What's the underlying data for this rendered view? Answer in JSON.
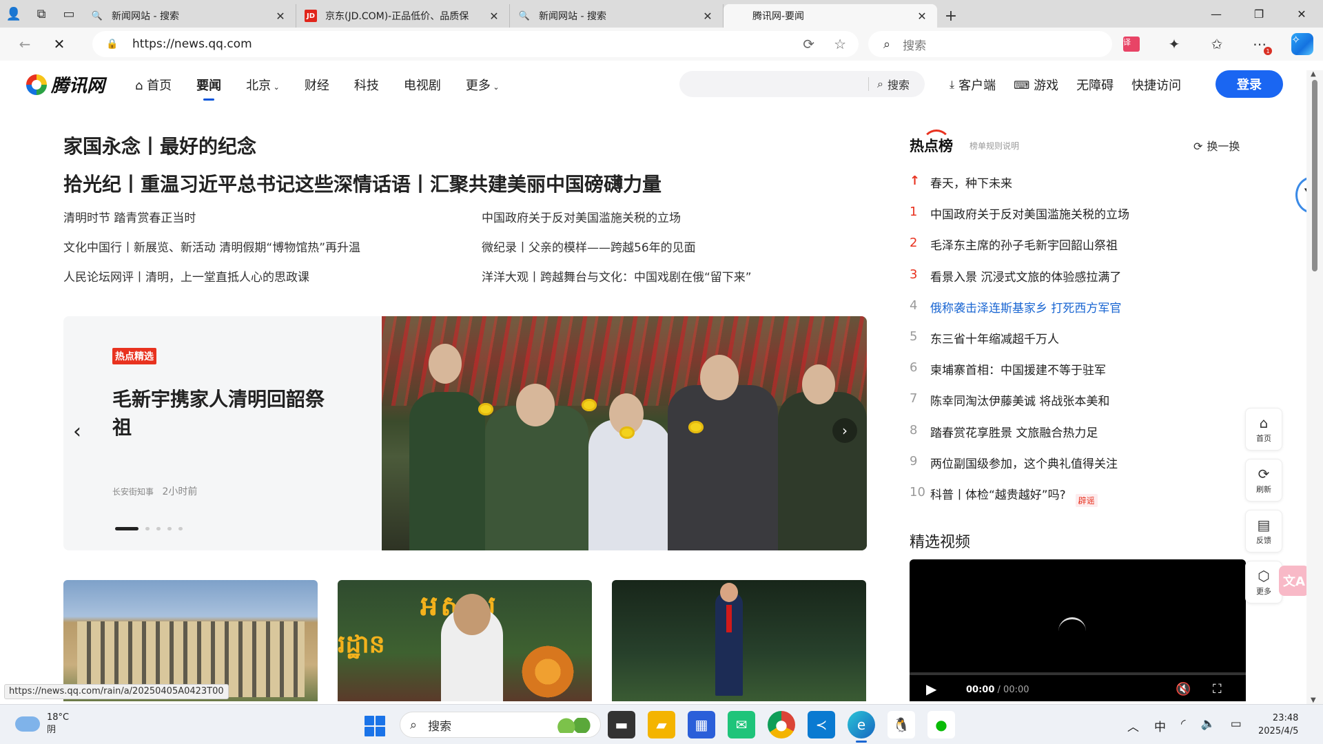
{
  "browser": {
    "tabs": [
      {
        "title": "新闻网站 - 搜索",
        "favicon": "search-icon",
        "active": false
      },
      {
        "title": "京东(JD.COM)-正品低价、品质保",
        "favicon": "jd-icon",
        "active": false
      },
      {
        "title": "新闻网站 - 搜索",
        "favicon": "search-icon",
        "active": false
      },
      {
        "title": "腾讯网-要闻",
        "favicon": "",
        "active": true
      }
    ],
    "url": "https://news.qq.com",
    "search_placeholder": "搜索"
  },
  "site": {
    "logo_text": "腾讯网",
    "nav": [
      {
        "label": "首页",
        "icon": "home-icon"
      },
      {
        "label": "要闻",
        "active": true
      },
      {
        "label": "北京",
        "dropdown": true
      },
      {
        "label": "财经"
      },
      {
        "label": "科技"
      },
      {
        "label": "电视剧"
      },
      {
        "label": "更多",
        "dropdown": true
      }
    ],
    "search_button": "搜索",
    "right_links": [
      {
        "label": "客户端",
        "icon": "download-icon"
      },
      {
        "label": "游戏",
        "icon": "gamepad-icon"
      },
      {
        "label": "无障碍"
      },
      {
        "label": "快捷访问"
      }
    ],
    "login": "登录"
  },
  "headlines": {
    "main1": "家国永念丨最好的纪念",
    "main2": "拾光纪丨重温习近平总书记这些深情话语丨汇聚共建美丽中国磅礴力量",
    "left": [
      "清明时节 踏青赏春正当时",
      "文化中国行丨新展览、新活动 清明假期“博物馆热”再升温",
      "人民论坛网评丨清明，上一堂直抵人心的思政课"
    ],
    "right": [
      "中国政府关于反对美国滥施关税的立场",
      "微纪录丨父亲的模样——跨越56年的见面",
      "洋洋大观丨跨越舞台与文化：中国戏剧在俄“留下来”"
    ]
  },
  "carousel": {
    "tag": "热点精选",
    "title": "毛新宇携家人清明回韶祭祖",
    "source": "长安街知事",
    "time": "2小时前",
    "dots": 5,
    "active_dot": 0
  },
  "hot": {
    "title": "热点榜",
    "rule": "榜单规则说明",
    "refresh": "换一换",
    "items": [
      {
        "rank": "↑",
        "title": "春天，种下未来",
        "pinned": true
      },
      {
        "rank": "1",
        "title": "中国政府关于反对美国滥施关税的立场"
      },
      {
        "rank": "2",
        "title": "毛泽东主席的孙子毛新宇回韶山祭祖"
      },
      {
        "rank": "3",
        "title": "看景入景 沉浸式文旅的体验感拉满了"
      },
      {
        "rank": "4",
        "title": "俄称袭击泽连斯基家乡 打死西方军官",
        "highlight": true
      },
      {
        "rank": "5",
        "title": "东三省十年缩减超千万人"
      },
      {
        "rank": "6",
        "title": "柬埔寨首相：中国援建不等于驻军"
      },
      {
        "rank": "7",
        "title": "陈幸同淘汰伊藤美诚 将战张本美和"
      },
      {
        "rank": "8",
        "title": "踏春赏花享胜景 文旅融合热力足"
      },
      {
        "rank": "9",
        "title": "两位副国级参加，这个典礼值得关注"
      },
      {
        "rank": "10",
        "title": "科普丨体检“越贵越好”吗?",
        "badge": "辟谣"
      }
    ]
  },
  "video": {
    "title": "精选视频",
    "current": "00:00",
    "total": "00:00"
  },
  "side_tools": [
    {
      "label": "首页",
      "icon": "home-icon"
    },
    {
      "label": "刷新",
      "icon": "refresh-icon"
    },
    {
      "label": "反馈",
      "icon": "feedback-icon"
    },
    {
      "label": "更多",
      "icon": "more-icon"
    }
  ],
  "status_url": "https://news.qq.com/rain/a/20250405A0423T00",
  "taskbar": {
    "temperature": "18°C",
    "weather": "阴",
    "search": "搜索",
    "ime": "中",
    "time": "23:48",
    "date": "2025/4/5"
  }
}
